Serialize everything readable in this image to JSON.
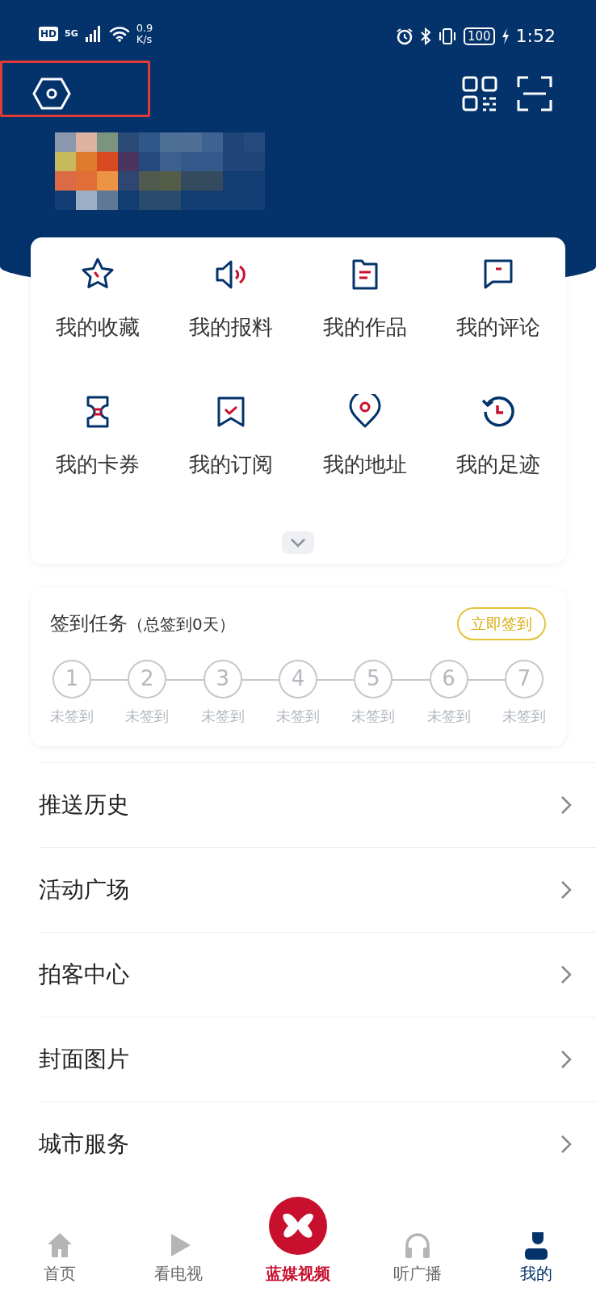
{
  "status_bar": {
    "hd": "HD",
    "network": "5G",
    "speed_value": "0.9",
    "speed_unit": "K/s",
    "battery": "100",
    "time": "1:52"
  },
  "annotation": {
    "kind": "highlight"
  },
  "shortcuts": [
    {
      "label": "我的收藏",
      "kind": "star"
    },
    {
      "label": "我的报料",
      "kind": "speaker"
    },
    {
      "label": "我的作品",
      "kind": "document"
    },
    {
      "label": "我的评论",
      "kind": "comment"
    },
    {
      "label": "我的卡券",
      "kind": "ticket"
    },
    {
      "label": "我的订阅",
      "kind": "bookmark"
    },
    {
      "label": "我的地址",
      "kind": "pin"
    },
    {
      "label": "我的足迹",
      "kind": "history"
    }
  ],
  "checkin": {
    "title": "签到任务",
    "total": "（总签到0天）",
    "button": "立即签到",
    "days": [
      {
        "number": "1",
        "label": "未签到",
        "signed": false
      },
      {
        "number": "2",
        "label": "未签到",
        "signed": false
      },
      {
        "number": "3",
        "label": "未签到",
        "signed": false
      },
      {
        "number": "4",
        "label": "未签到",
        "signed": false
      },
      {
        "number": "5",
        "label": "未签到",
        "signed": false
      },
      {
        "number": "6",
        "label": "未签到",
        "signed": false
      },
      {
        "number": "7",
        "label": "未签到",
        "signed": false
      }
    ]
  },
  "menu": [
    "推送历史",
    "活动广场",
    "拍客中心",
    "封面图片",
    "城市服务"
  ],
  "tab_bar": [
    {
      "label": "首页",
      "kind": "home",
      "selected": false
    },
    {
      "label": "看电视",
      "kind": "play",
      "selected": false
    },
    {
      "label": "蓝媒视频",
      "kind": "center",
      "selected": false
    },
    {
      "label": "听广播",
      "kind": "headphones",
      "selected": false
    },
    {
      "label": "我的",
      "kind": "person",
      "selected": true
    }
  ]
}
